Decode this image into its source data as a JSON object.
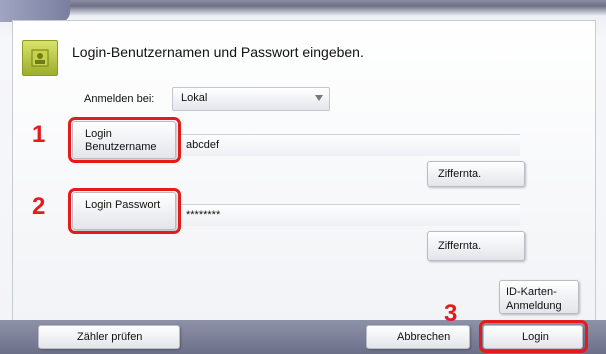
{
  "dialog": {
    "title": "Login-Benutzernamen und Passwort eingeben.",
    "login_at_label": "Anmelden bei:",
    "login_at_value": "Lokal"
  },
  "fields": {
    "username_button": "Login Benutzername",
    "username_value": "abcdef",
    "username_keypad": "Ziffernta.",
    "password_button": "Login Passwort",
    "password_value": "********",
    "password_keypad": "Ziffernta."
  },
  "buttons": {
    "id_card": "ID-Karten-Anmeldung",
    "counter": "Zähler prüfen",
    "cancel": "Abbrechen",
    "login": "Login"
  },
  "callouts": [
    "1",
    "2",
    "3"
  ],
  "colors": {
    "highlight": "#e51b1b"
  }
}
